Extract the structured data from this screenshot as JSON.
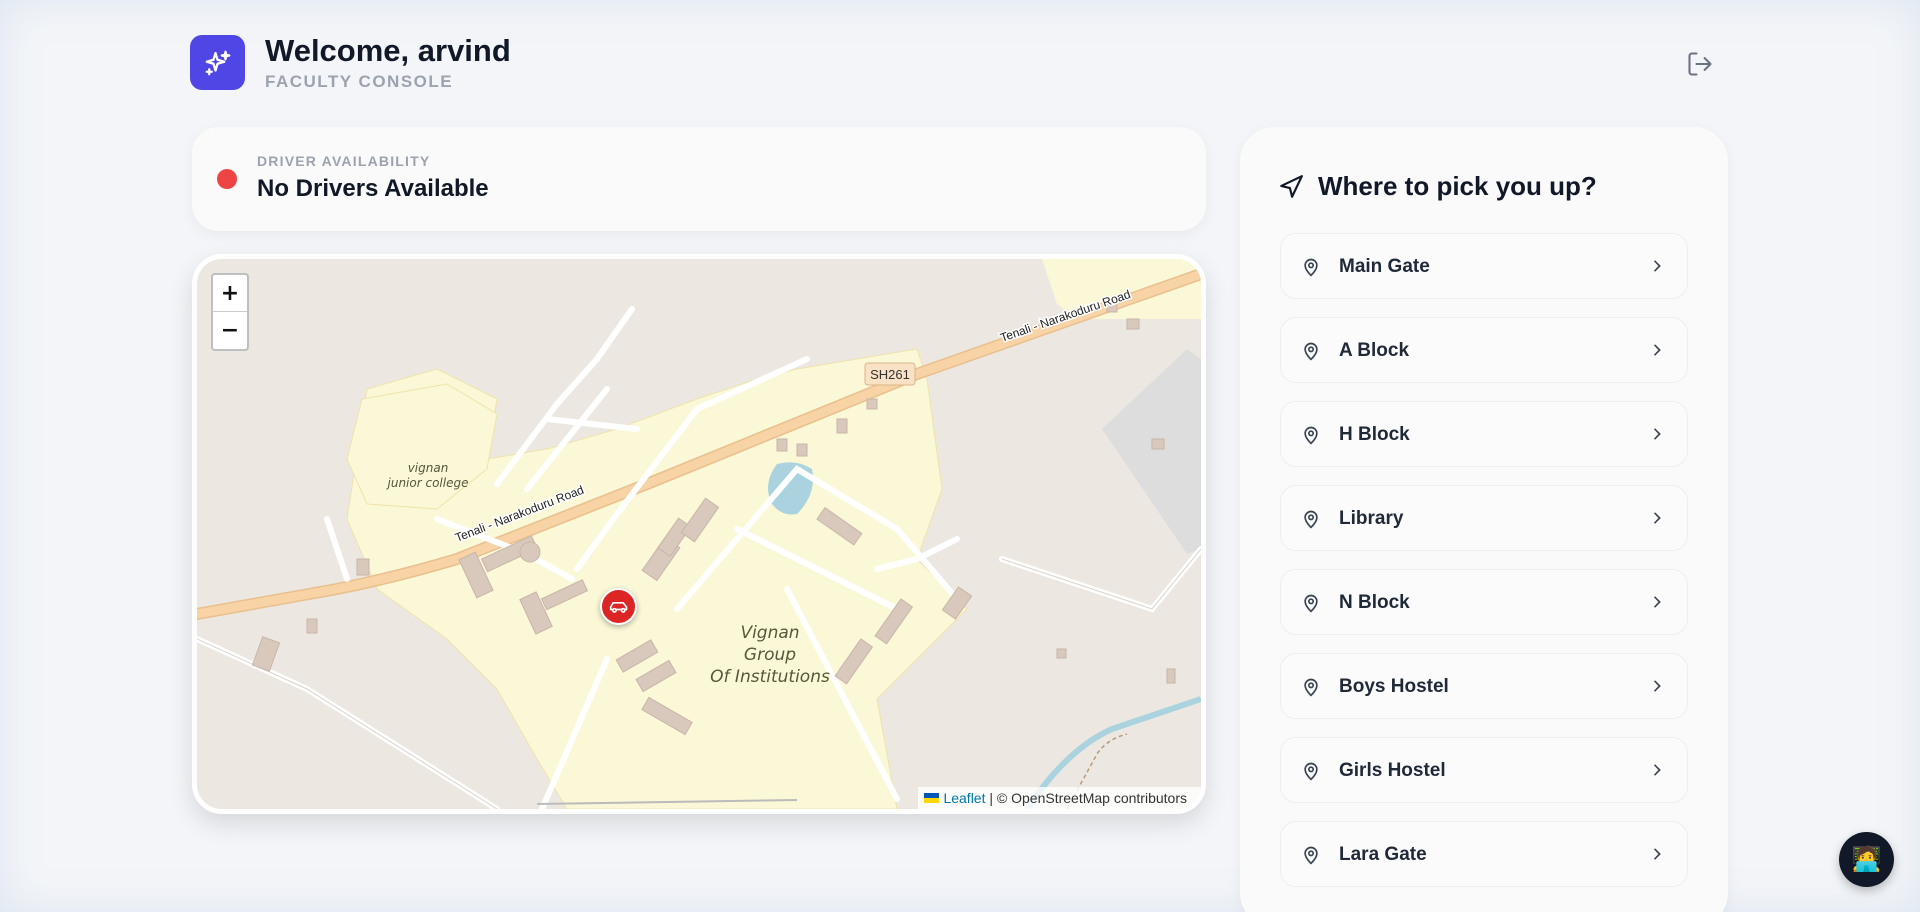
{
  "header": {
    "welcome": "Welcome, arvind",
    "subtitle": "FACULTY CONSOLE",
    "logo_icon": "sparkles-icon",
    "logout_icon": "logout-icon",
    "accent_color": "#4f46e5"
  },
  "driver": {
    "label": "DRIVER AVAILABILITY",
    "status": "No Drivers Available",
    "status_color": "#ef4444"
  },
  "map": {
    "zoom_in": "+",
    "zoom_out": "−",
    "attribution_link": "Leaflet",
    "attribution_text": " | © OpenStreetMap contributors",
    "labels": {
      "road_top": "Tenali - Narakoduru Road",
      "road_left": "Tenali - Narakoduru Road",
      "route_shield": "SH261",
      "college_line1": "vignan",
      "college_line2": "junior college",
      "campus_line1": "Vignan",
      "campus_line2": "Group",
      "campus_line3": "Of Institutions"
    },
    "marker_icon": "car-icon",
    "marker_color": "#dc2626"
  },
  "pickup": {
    "title": "Where to pick you up?",
    "title_icon": "navigation-arrow-icon",
    "locations": [
      {
        "label": "Main Gate"
      },
      {
        "label": "A Block"
      },
      {
        "label": "H Block"
      },
      {
        "label": "Library"
      },
      {
        "label": "N Block"
      },
      {
        "label": "Boys Hostel"
      },
      {
        "label": "Girls Hostel"
      },
      {
        "label": "Lara Gate"
      }
    ]
  },
  "chat": {
    "icon": "assistant-avatar-icon",
    "glyph": "🧑‍💻"
  }
}
